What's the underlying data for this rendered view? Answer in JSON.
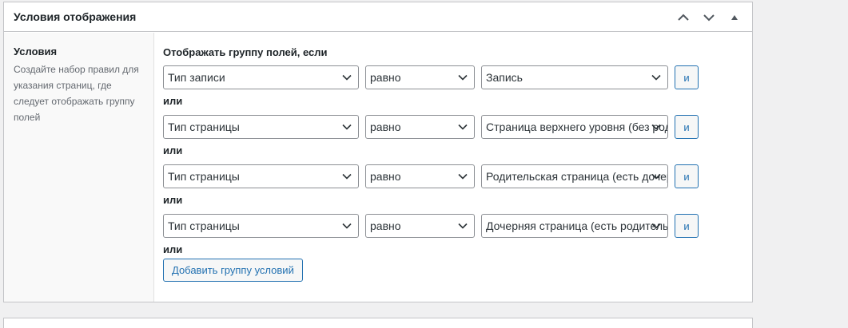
{
  "postbox": {
    "title": "Условия отображения"
  },
  "label": {
    "title": "Условия",
    "description": "Создайте набор правил для указания страниц, где следует отображать группу полей"
  },
  "rules": {
    "title": "Отображать группу полей, если",
    "or_label": "или",
    "and_label": "и",
    "add_group_label": "Добавить группу условий",
    "rows": [
      {
        "param": "Тип записи",
        "operator": "равно",
        "value": "Запись"
      },
      {
        "param": "Тип страницы",
        "operator": "равно",
        "value": "Страница верхнего уровня (без родителя)"
      },
      {
        "param": "Тип страницы",
        "operator": "равно",
        "value": "Родительская страница (есть дочерние)"
      },
      {
        "param": "Тип страницы",
        "operator": "равно",
        "value": "Дочерняя страница (есть родитель)"
      }
    ]
  },
  "icons": {
    "move_up": "chevron-up-icon",
    "move_down": "chevron-down-icon",
    "toggle": "triangle-up-icon",
    "select_arrow": "chevron-down-icon"
  },
  "colors": {
    "accent": "#2271b1",
    "border": "#c3c4c7",
    "background": "#f0f0f1"
  }
}
